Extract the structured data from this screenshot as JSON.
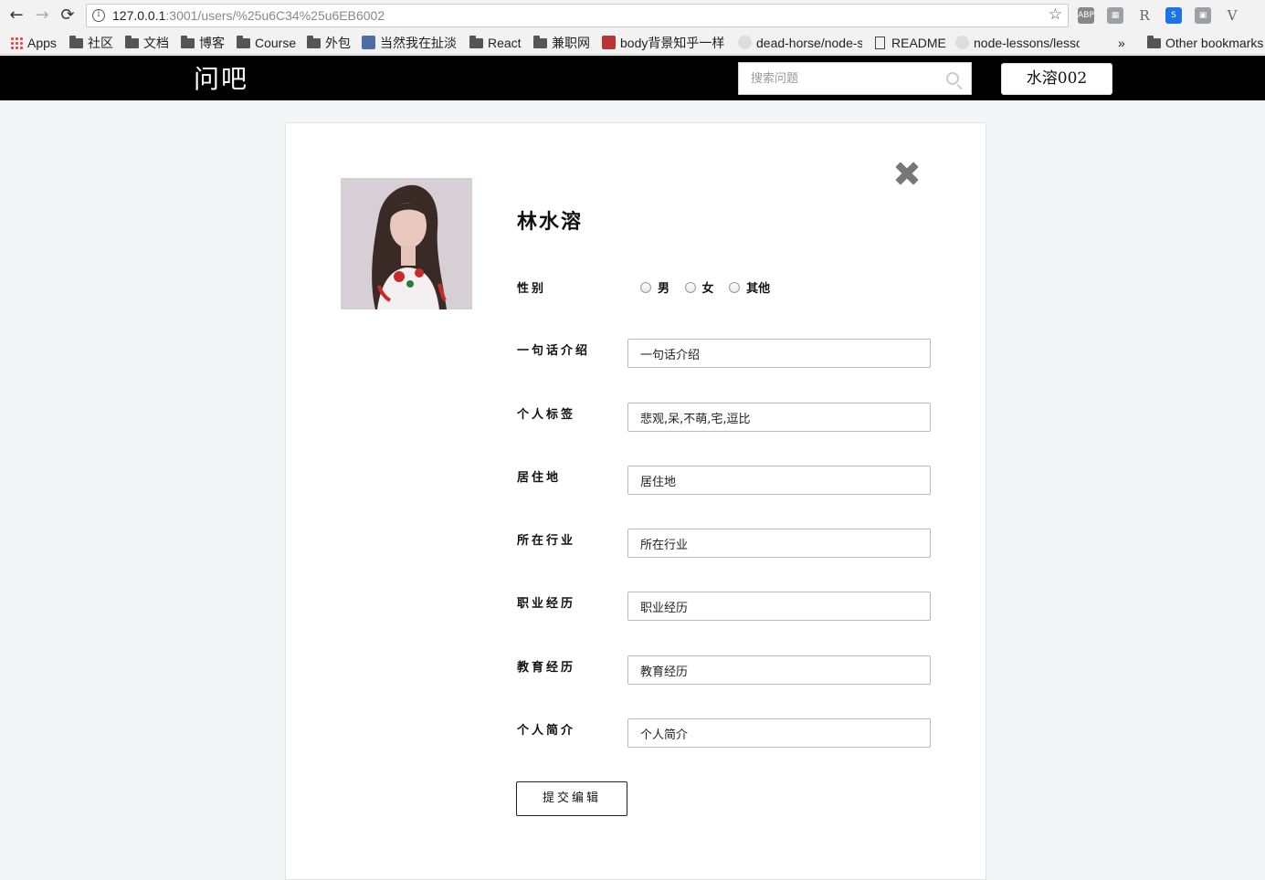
{
  "browser": {
    "url_host": "127.0.0.1",
    "url_rest": ":3001/users/%25u6C34%25u6EB6002",
    "nav_back": "←",
    "nav_forward": "→",
    "nav_reload": "⟳",
    "info_glyph": "i",
    "star_glyph": "☆",
    "extensions": [
      {
        "name": "adblock-icon",
        "label": "ABP",
        "color": "#888888"
      },
      {
        "name": "image-extension-icon",
        "label": "▦",
        "color": "#9aa0a6"
      },
      {
        "name": "r-extension-icon",
        "label": "R",
        "color": "#f2f2f2"
      },
      {
        "name": "s-extension-icon",
        "label": "S",
        "color": "#1a73e8"
      },
      {
        "name": "window-extension-icon",
        "label": "▣",
        "color": "#9aa0a6"
      },
      {
        "name": "v-extension-icon",
        "label": "V",
        "color": "#f2f2f2"
      }
    ]
  },
  "bookmarks": {
    "apps": "Apps",
    "items": [
      "社区",
      "文档",
      "博客",
      "Course",
      "外包",
      "当然我在扯淡",
      "React",
      "兼职网",
      "body背景知乎一样",
      "dead-horse/node-s",
      "README",
      "node-lessons/lesso"
    ],
    "more": "»",
    "other": "Other bookmarks"
  },
  "header": {
    "logo": "问吧",
    "search_placeholder": "搜索问题",
    "user_button": "水溶002"
  },
  "profile": {
    "name": "林水溶",
    "gender_label": "性别",
    "gender_options": [
      "男",
      "女",
      "其他"
    ],
    "fields": [
      {
        "label": "一句话介绍",
        "value": "一句话介绍"
      },
      {
        "label": "个人标签",
        "value": "悲观,呆,不萌,宅,逗比"
      },
      {
        "label": "居住地",
        "value": "居住地"
      },
      {
        "label": "所在行业",
        "value": "所在行业"
      },
      {
        "label": "职业经历",
        "value": "职业经历"
      },
      {
        "label": "教育经历",
        "value": "教育经历"
      },
      {
        "label": "个人简介",
        "value": "个人简介"
      }
    ],
    "submit": "提交编辑"
  },
  "colors": {
    "header_bg": "#000000",
    "page_bg": "#f4f5f7",
    "close_icon": "#777777"
  }
}
